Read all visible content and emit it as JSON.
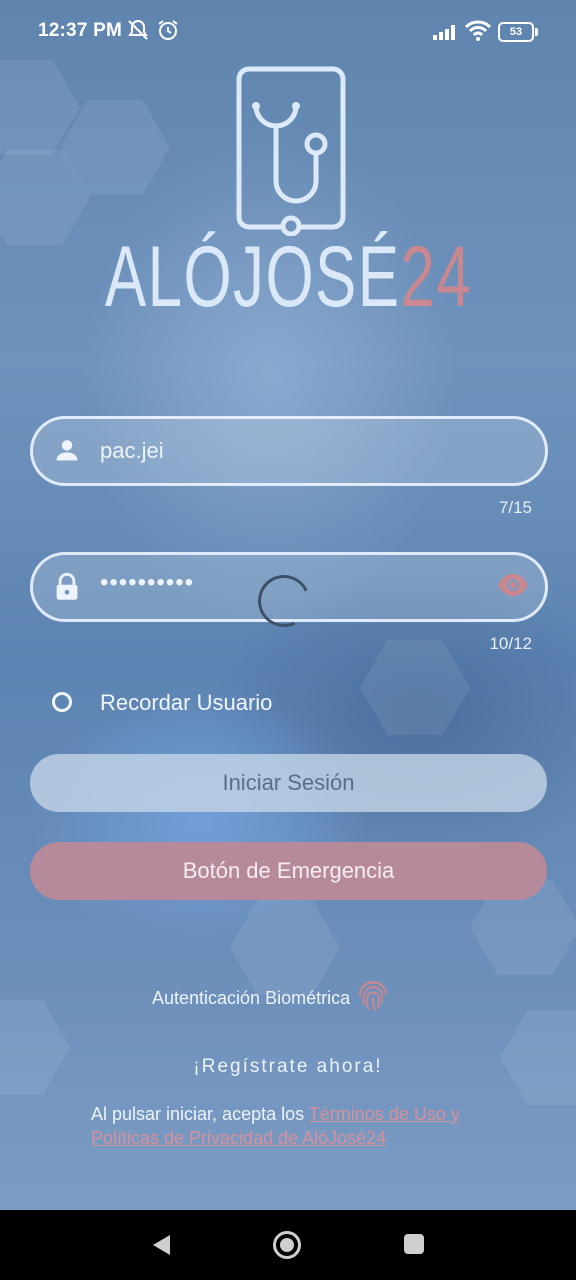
{
  "status_bar": {
    "time": "12:37 PM",
    "battery": "53",
    "icons": [
      "mute-icon",
      "alarm-icon",
      "signal-icon",
      "wifi-icon",
      "battery-icon"
    ]
  },
  "brand": {
    "name_main": "ALÓJOSÉ",
    "name_accent": "24",
    "accent_color": "#c98790",
    "logo_icon": "stethoscope-phone-icon"
  },
  "username": {
    "value": "pac.jei",
    "counter": "7/15",
    "icon": "user-icon"
  },
  "password": {
    "value": "••••••••••",
    "counter": "10/12",
    "icon": "lock-icon",
    "toggle_icon": "eye-icon"
  },
  "remember": {
    "label": "Recordar Usuario",
    "checked": false
  },
  "buttons": {
    "login": "Iniciar Sesión",
    "emergency": "Botón de Emergencia",
    "emergency_color": "#b78a9b"
  },
  "biometric": {
    "label": "Autenticación Biométrica",
    "icon": "fingerprint-icon"
  },
  "register": {
    "label": "¡Regístrate ahora!"
  },
  "terms": {
    "prefix": "Al pulsar iniciar, acepta los ",
    "link": "Términos de Uso y Políticas de Privacidad de AlóJosé24"
  },
  "navigation": {
    "icons": [
      "back-icon",
      "home-icon",
      "recents-icon"
    ]
  }
}
